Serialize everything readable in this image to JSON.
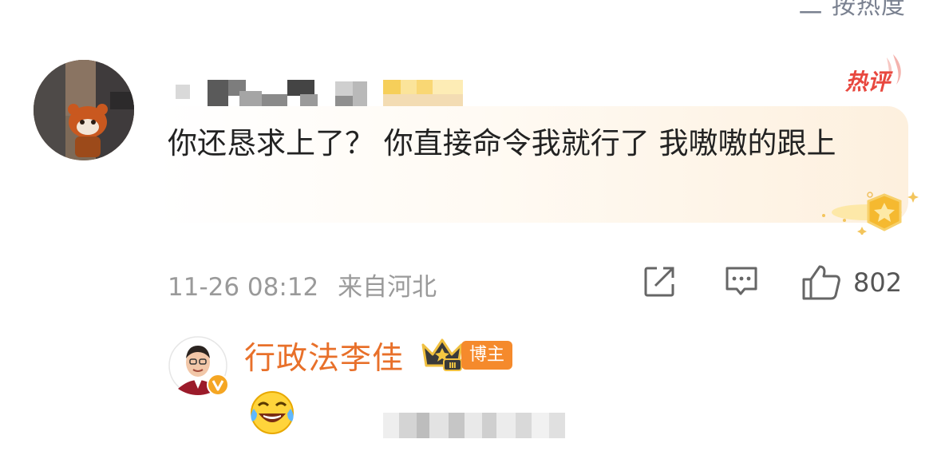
{
  "header": {
    "sort_label": "二 按热度"
  },
  "comment": {
    "badge": "热评",
    "text": "你还恳求上了？ 你直接命令我就行了 我嗷嗷的跟上",
    "timestamp": "11-26 08:12",
    "location": "来自河北",
    "likes": "802"
  },
  "reply": {
    "author": "行政法李佳",
    "crown_level": "Ⅲ",
    "role_badge": "博主"
  },
  "icons": {
    "share": "share-icon",
    "reply": "comment-icon",
    "like": "thumbs-up-icon",
    "medal": "star-medal-icon",
    "emoji": "laughing-tears-emoji"
  },
  "colors": {
    "accent": "#e8702a",
    "hot_badge": "#e8483f",
    "badge_bg": "#f58a2c",
    "meta_text": "#9a9a9a"
  }
}
